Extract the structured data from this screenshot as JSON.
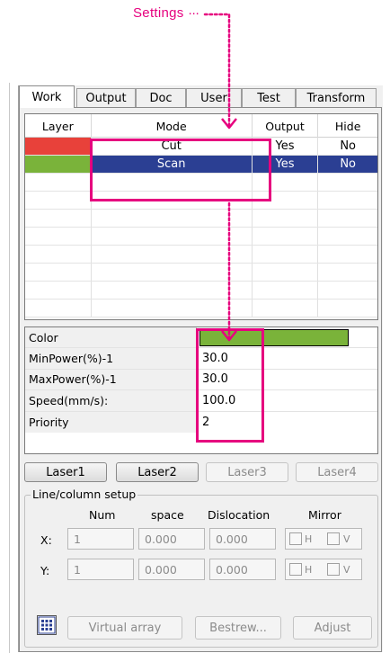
{
  "annotation": {
    "label": "Settings"
  },
  "tabs": [
    "Work",
    "Output",
    "Doc",
    "User",
    "Test",
    "Transform"
  ],
  "layer_table": {
    "headers": [
      "Layer",
      "Mode",
      "Output",
      "Hide"
    ],
    "rows": [
      {
        "color": "#e8413a",
        "mode": "Cut",
        "output": "Yes",
        "hide": "No"
      },
      {
        "color": "#7ab33a",
        "mode": "Scan",
        "output": "Yes",
        "hide": "No"
      }
    ]
  },
  "properties": {
    "color": {
      "label": "Color",
      "value": "#7ab33a"
    },
    "min_power": {
      "label": "MinPower(%)-1",
      "value": "30.0"
    },
    "max_power": {
      "label": "MaxPower(%)-1",
      "value": "30.0"
    },
    "speed": {
      "label": "Speed(mm/s):",
      "value": "100.0"
    },
    "priority": {
      "label": "Priority",
      "value": "2"
    }
  },
  "lasers": [
    "Laser1",
    "Laser2",
    "Laser3",
    "Laser4"
  ],
  "line_column": {
    "title": "Line/column setup",
    "headers": {
      "num": "Num",
      "space": "space",
      "dislocation": "Dislocation",
      "mirror": "Mirror"
    },
    "x": {
      "label": "X:",
      "num": "1",
      "space": "0.000",
      "dislocation": "0.000",
      "h": "H",
      "v": "V"
    },
    "y": {
      "label": "Y:",
      "num": "1",
      "space": "0.000",
      "dislocation": "0.000",
      "h": "H",
      "v": "V"
    },
    "buttons": {
      "virtual_array": "Virtual array",
      "bestrew": "Bestrew...",
      "adjust": "Adjust"
    }
  },
  "colors": {
    "accent": "#e6007e",
    "selection": "#2b3f93"
  }
}
